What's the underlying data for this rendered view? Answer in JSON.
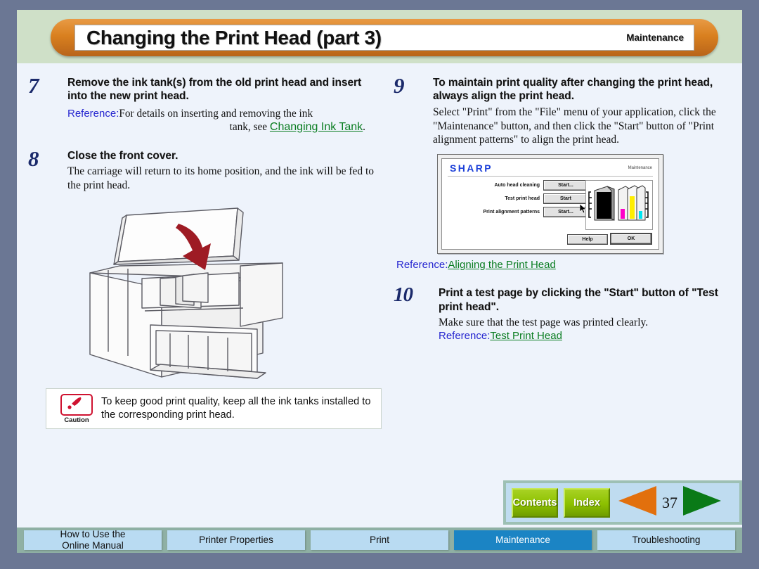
{
  "header": {
    "title": "Changing the Print Head (part 3)",
    "section": "Maintenance"
  },
  "steps": {
    "s7": {
      "number": "7",
      "title": "Remove the ink tank(s) from the old print head and insert into the new print head.",
      "ref_label": "Reference:",
      "ref_text": "For details on inserting and removing the ink",
      "ref_text_2": "tank, see ",
      "ref_link": "Changing Ink Tank",
      "ref_period": "."
    },
    "s8": {
      "number": "8",
      "title": "Close the front cover.",
      "desc": "The carriage will return to its home position, and the ink will be fed to the print head."
    },
    "s9": {
      "number": "9",
      "title": "To maintain print quality after changing the print head, always align the print head.",
      "desc": "Select \"Print\" from the \"File\" menu of your application, click the \"Maintenance\" button, and then click the \"Start\" button of \"Print alignment patterns\" to align the print head.",
      "ref_label": "Reference:",
      "ref_link": "Aligning the Print Head"
    },
    "s10": {
      "number": "10",
      "title": "Print a test page by clicking the \"Start\" button of \"Test print head\".",
      "desc": "Make sure that the test page was printed clearly.",
      "ref_label": "Reference:",
      "ref_link": "Test Print Head"
    }
  },
  "caution": {
    "label": "Caution",
    "text": "To keep good print quality, keep all the ink tanks installed to the corresponding print head."
  },
  "dialog": {
    "logo": "SHARP",
    "section": "Maintenance",
    "rows": [
      {
        "label": "Auto head cleaning",
        "button": "Start..."
      },
      {
        "label": "Test print head",
        "button": "Start"
      },
      {
        "label": "Print alignment patterns",
        "button": "Start..."
      }
    ],
    "help_button": "Help",
    "ok_button": "OK",
    "ink_colors": [
      "#000000",
      "#ff00c8",
      "#ffee00",
      "#00e5f0"
    ]
  },
  "nav": {
    "contents": "Contents",
    "index": "Index",
    "page": "37",
    "prev_color": "#e2700d",
    "next_color": "#0a7a17"
  },
  "tabs": [
    {
      "line1": "How to Use the",
      "line2": "Online Manual",
      "active": false
    },
    {
      "line1": "Printer Properties",
      "line2": "",
      "active": false
    },
    {
      "line1": "Print",
      "line2": "",
      "active": false
    },
    {
      "line1": "Maintenance",
      "line2": "",
      "active": true
    },
    {
      "line1": "Troubleshooting",
      "line2": "",
      "active": false
    }
  ],
  "colors": {
    "frame": "#6b7794",
    "page_bg": "#eef3fb",
    "header_band": "#cfe0c8",
    "capsule": "#d9801f",
    "step_number": "#1b2a6b",
    "reference": "#2727d0",
    "link": "#0a7d21",
    "tab_active": "#1b84c4",
    "tab_inactive": "#b9dbf2",
    "tabbar": "#8fb0a4",
    "arrow_printer": "#9e1b24"
  }
}
